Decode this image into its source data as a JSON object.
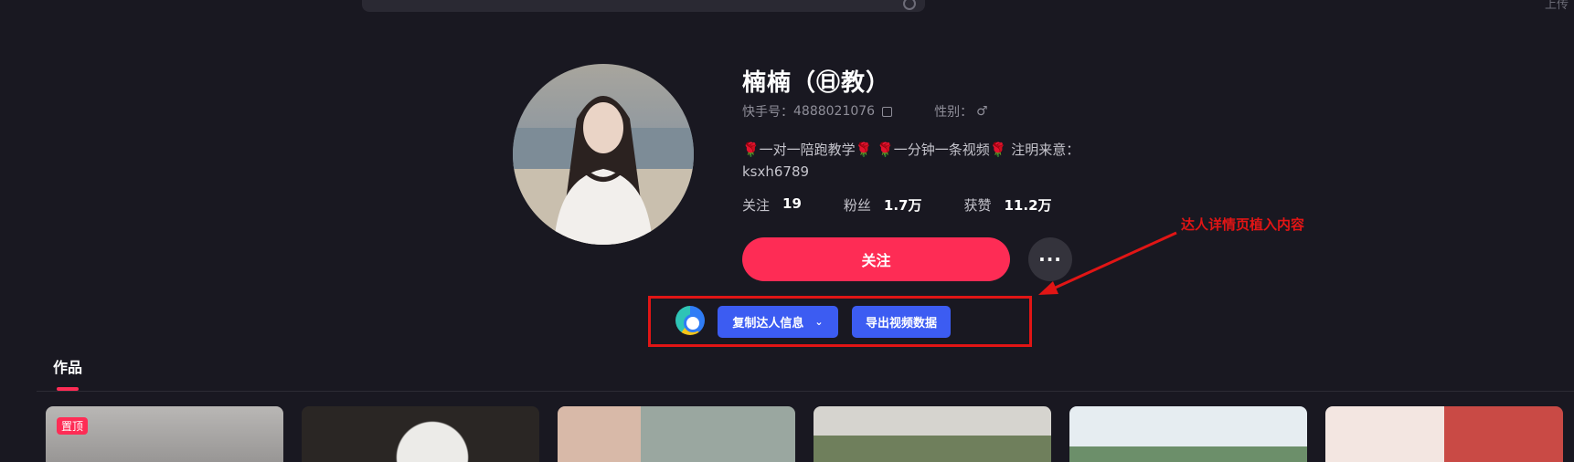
{
  "corner_text": "上传",
  "profile": {
    "nickname": "楠楠（㊐教）",
    "kuaishou_id_label": "快手号：",
    "kuaishou_id": "4888021076",
    "gender_label": "性别：",
    "gender_icon": "♂",
    "bio_line1": "🌹一对一陪跑教学🌹 🌹一分钟一条视频🌹 注明来意：",
    "bio_line2": "ksxh6789",
    "stats": [
      {
        "label": "关注",
        "value": "19"
      },
      {
        "label": "粉丝",
        "value": "1.7万"
      },
      {
        "label": "获赞",
        "value": "11.2万"
      }
    ],
    "follow_label": "关注",
    "more_label": "···"
  },
  "plugin": {
    "copy_info_label": "复制达人信息",
    "export_label": "导出视频数据"
  },
  "annotation": {
    "text": "达人详情页植入内容",
    "color": "#e11515"
  },
  "tabs": {
    "works_label": "作品"
  },
  "thumbnails": [
    {
      "badge": "置顶"
    },
    {
      "badge": ""
    },
    {
      "badge": ""
    },
    {
      "badge": ""
    },
    {
      "badge": ""
    },
    {
      "badge": ""
    }
  ],
  "colors": {
    "background": "#191821",
    "accent": "#fe2c55",
    "plugin_button": "#3c5cf2"
  }
}
